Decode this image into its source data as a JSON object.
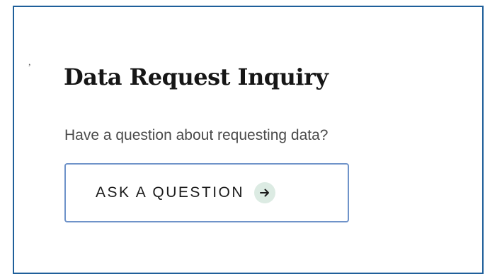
{
  "card": {
    "title": "Data Request Inquiry",
    "subtitle": "Have a question about requesting data?",
    "button_label": "ASK A QUESTION",
    "button_icon": "arrow-right-icon",
    "stray_mark": ","
  },
  "colors": {
    "card_border": "#1f5f9a",
    "button_border": "#6f93c9",
    "icon_bg": "#dcebe3",
    "title_text": "#161616",
    "subtitle_text": "#4a4a4a"
  }
}
